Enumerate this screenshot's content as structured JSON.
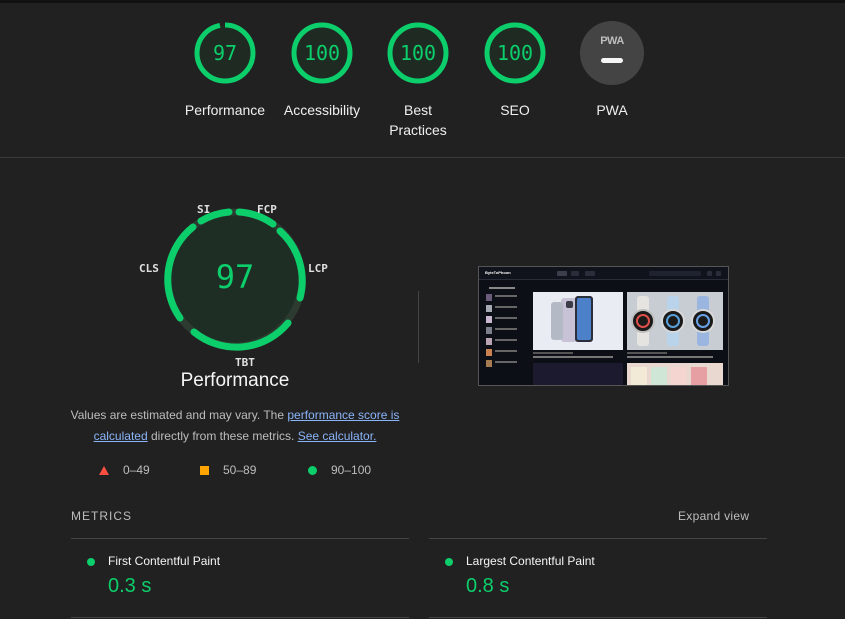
{
  "summary": {
    "categories": [
      {
        "name": "Performance",
        "score": "97",
        "value": 97
      },
      {
        "name": "Accessibility",
        "score": "100",
        "value": 100
      },
      {
        "name": "Best Practices",
        "score": "100",
        "value": 100
      },
      {
        "name": "SEO",
        "score": "100",
        "value": 100
      },
      {
        "name": "PWA",
        "badge": "PWA"
      }
    ]
  },
  "performance": {
    "score": "97",
    "title": "Performance",
    "metric_tags": {
      "si": "SI",
      "fcp": "FCP",
      "lcp": "LCP",
      "tbt": "TBT",
      "cls": "CLS"
    },
    "description": {
      "part1": "Values are estimated and may vary. The ",
      "link1": "performance score is calculated",
      "part2": " directly from these metrics. ",
      "link2": "See calculator."
    },
    "legend": {
      "fail": "0–49",
      "average": "50–89",
      "pass": "90–100"
    }
  },
  "thumbnail": {
    "brand": "ByteToPhoon"
  },
  "metrics": {
    "heading": "METRICS",
    "expand_label": "Expand view",
    "items": [
      {
        "title": "First Contentful Paint",
        "value": "0.3 s"
      },
      {
        "title": "Largest Contentful Paint",
        "value": "0.8 s"
      }
    ]
  },
  "colors": {
    "pass": "#0cce6b",
    "average": "#ffa400",
    "fail": "#ff4e42",
    "link": "#8ab4f8",
    "background": "#212121"
  }
}
